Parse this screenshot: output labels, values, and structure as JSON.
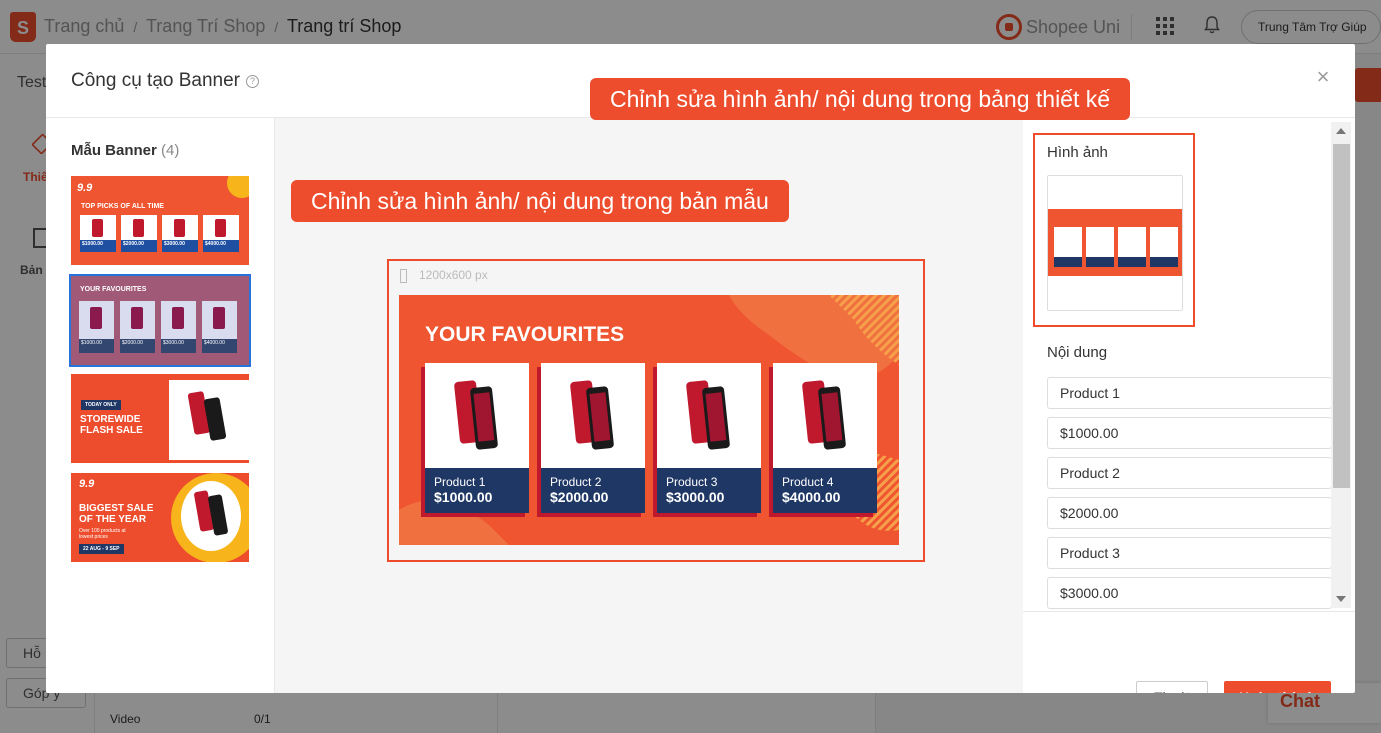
{
  "header": {
    "logo_letter": "S",
    "breadcrumb": [
      "Trang chủ",
      "Trang Trí Shop",
      "Trang trí Shop"
    ],
    "separator": "/",
    "uni_label": "Shopee Uni",
    "help_label": "Trung Tâm Trợ Giúp"
  },
  "background": {
    "shop_name": "Test",
    "side_item_1": "Thiế",
    "side_item_2": "Bản",
    "btn_1": "Hỗ",
    "btn_2": "Góp ý",
    "video_label": "Video",
    "video_count": "0/1",
    "chat_label": "Chat"
  },
  "modal": {
    "title": "Công cụ tạo Banner",
    "info_glyph": "?",
    "close_glyph": "×",
    "templates": {
      "heading": "Mẫu Banner",
      "count": "(4)",
      "items": [
        {
          "badge": "9.9",
          "title": "TOP PICKS OF ALL TIME",
          "prices": [
            "$1000.00",
            "$2000.00",
            "$3000.00",
            "$4000.00"
          ]
        },
        {
          "title": "YOUR FAVOURITES",
          "prices": [
            "$1000.00",
            "$2000.00",
            "$3000.00",
            "$4000.00"
          ]
        },
        {
          "tag": "TODAY ONLY",
          "title": "STOREWIDE FLASH SALE"
        },
        {
          "badge": "9.9",
          "title": "BIGGEST SALE OF THE YEAR",
          "sub": "Over 100 products at lowest prices",
          "dates": "22 AUG - 9 SEP"
        }
      ]
    },
    "callout_left": "Chỉnh sửa hình ảnh/ nội dung trong bản mẫu",
    "callout_right": "Chỉnh sửa hình ảnh/ nội dung trong bảng thiết kế",
    "canvas": {
      "size_label": "1200x600 px",
      "banner_title": "YOUR FAVOURITES",
      "products": [
        {
          "name": "Product 1",
          "price": "$1000.00"
        },
        {
          "name": "Product 2",
          "price": "$2000.00"
        },
        {
          "name": "Product 3",
          "price": "$3000.00"
        },
        {
          "name": "Product 4",
          "price": "$4000.00"
        }
      ]
    },
    "editor": {
      "image_label": "Hình ảnh",
      "content_label": "Nội dung",
      "fields": [
        "Product 1",
        "$1000.00",
        "Product 2",
        "$2000.00",
        "Product 3",
        "$3000.00"
      ]
    },
    "footer": {
      "exit_label": "Thoát",
      "done_label": "Hoàn thành"
    }
  },
  "colors": {
    "brand": "#ee4d2d",
    "banner_bg": "#ee5530",
    "card_footer": "#1e3765",
    "selected_outline": "#2673dd"
  }
}
